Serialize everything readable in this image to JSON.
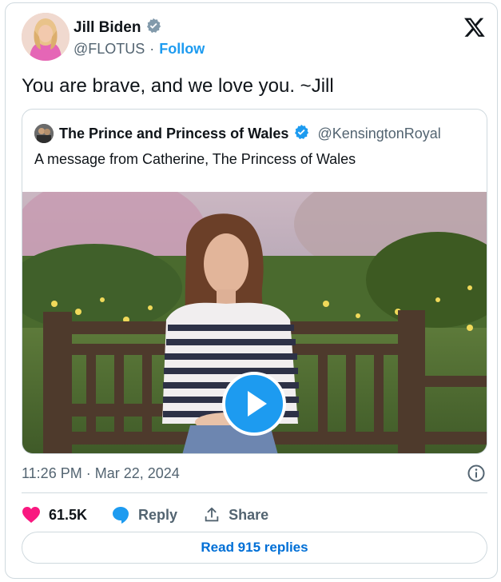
{
  "author": {
    "name": "Jill Biden",
    "handle": "@FLOTUS",
    "separator": "·",
    "follow_label": "Follow",
    "verified_color": "#829aab"
  },
  "tweet": {
    "text": "You are brave, and we love you. ~Jill"
  },
  "quoted_tweet": {
    "name": "The Prince and Princess of Wales",
    "handle": "@KensingtonRoyal",
    "text": "A message from Catherine, The Princess of Wales",
    "verified_color": "#1d9bf0",
    "media_type": "video"
  },
  "meta": {
    "timestamp": "11:26 PM · Mar 22, 2024"
  },
  "actions": {
    "likes_count": "61.5K",
    "reply_label": "Reply",
    "share_label": "Share"
  },
  "footer": {
    "read_replies_label": "Read 915 replies"
  },
  "colors": {
    "accent": "#1d9bf0",
    "like": "#f91880",
    "secondary_text": "#536471",
    "border": "#cfd9de"
  },
  "icons": [
    "x-logo-icon",
    "verified-badge-icon",
    "play-icon",
    "info-icon",
    "heart-icon",
    "reply-bubble-icon",
    "share-icon"
  ]
}
